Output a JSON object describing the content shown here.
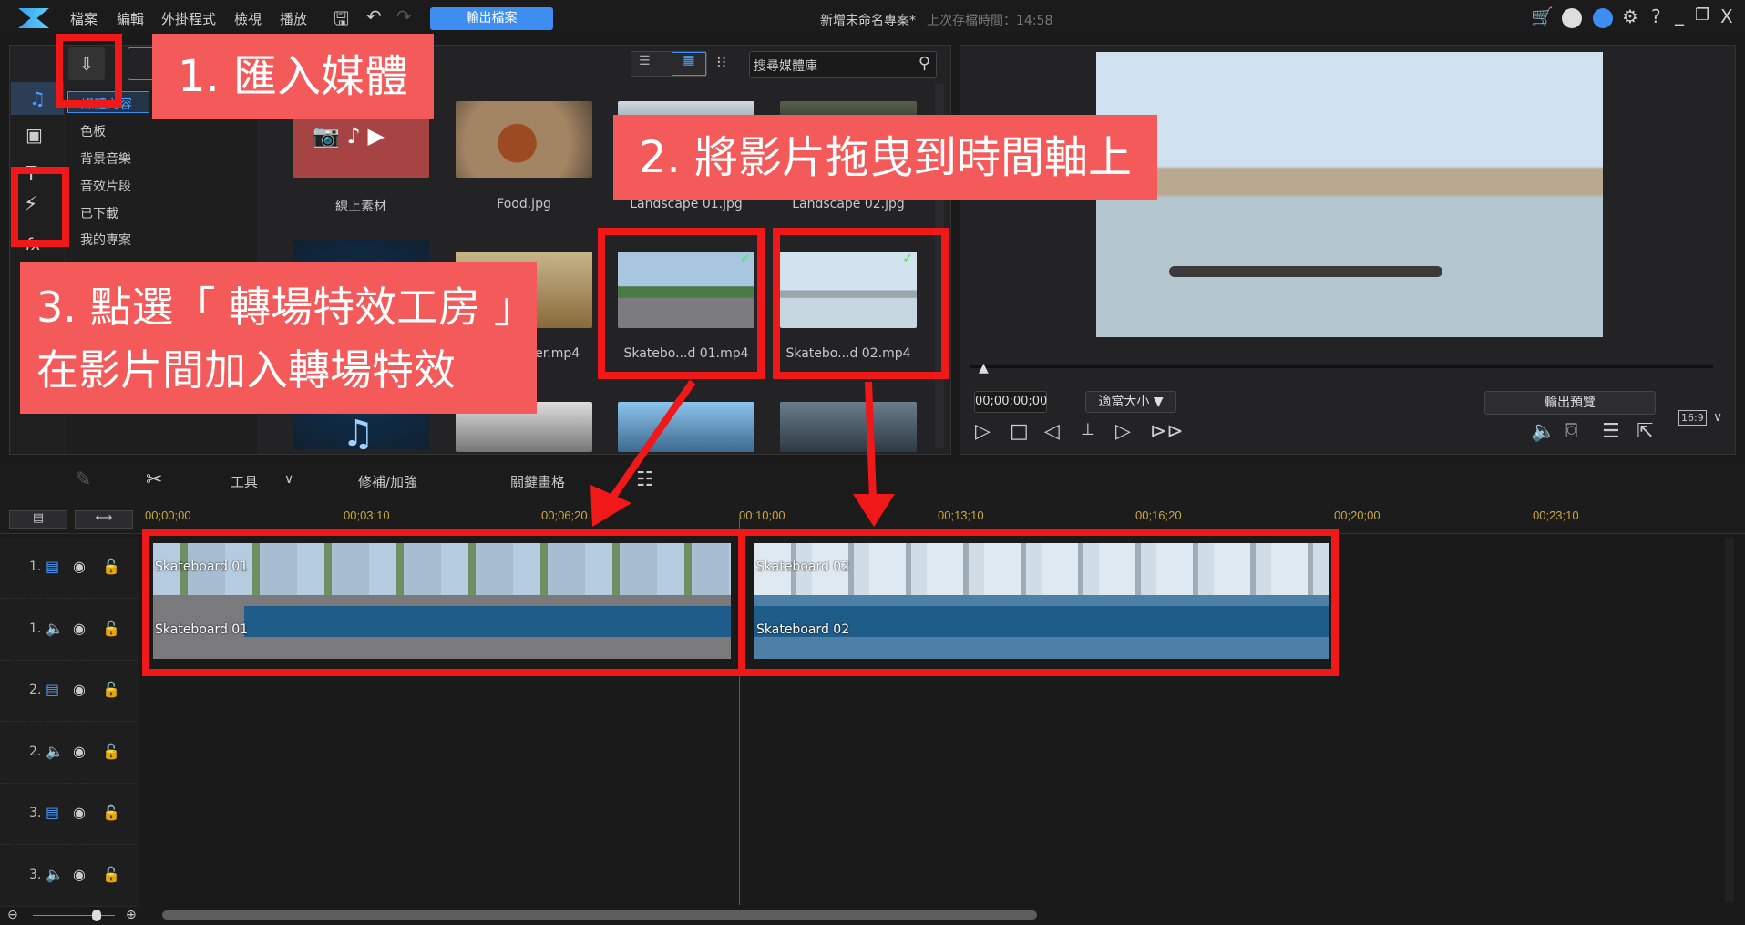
{
  "titlebar": {
    "menus": [
      "檔案",
      "編輯",
      "外掛程式",
      "檢視",
      "播放"
    ],
    "export_label": "輸出檔案",
    "project_title": "新增未命名專案*",
    "last_saved": "上次存檔時間：14:58"
  },
  "library": {
    "search_placeholder": "搜尋媒體庫",
    "categories": [
      "媒體內容",
      "色板",
      "背景音樂",
      "音效片段",
      "已下載",
      "我的專案"
    ],
    "items": [
      {
        "label": "線上素材"
      },
      {
        "label": "Food.jpg"
      },
      {
        "label": "Landscape 01.jpg"
      },
      {
        "label": "Landscape 02.jpg"
      },
      {
        "label": ""
      },
      {
        "label": "...er.mp4"
      },
      {
        "label": "Skatebo...d 01.mp4"
      },
      {
        "label": "Skatebo...d 02.mp4"
      }
    ]
  },
  "callouts": {
    "step1": "1. 匯入媒體",
    "step2": "2. 將影片拖曳到時間軸上",
    "step3_line1": "3. 點選「 轉場特效工房 」",
    "step3_line2": "在影片間加入轉場特效"
  },
  "preview": {
    "timecode": "00;00;00;00",
    "fit_label": "適當大小 ▼",
    "export_preview": "輸出預覽",
    "aspect": "16:9"
  },
  "timeline_toolbar": {
    "tools": "工具",
    "fix": "修補/加強",
    "keyframe": "關鍵畫格"
  },
  "ruler": [
    "00;00;00",
    "00;03;10",
    "00;06;20",
    "00;10;00",
    "00;13;10",
    "00;16;20",
    "00;20;00",
    "00;23;10"
  ],
  "tracks": [
    {
      "num": "1.",
      "type": "video"
    },
    {
      "num": "1.",
      "type": "audio"
    },
    {
      "num": "2.",
      "type": "video"
    },
    {
      "num": "2.",
      "type": "audio"
    },
    {
      "num": "3.",
      "type": "video"
    },
    {
      "num": "3.",
      "type": "audio"
    }
  ],
  "clips": [
    {
      "video": "Skateboard 01",
      "audio": "Skateboard 01"
    },
    {
      "video": "Skateboard 02",
      "audio": "Skateboard 02"
    }
  ],
  "colors": {
    "accent": "#3d8ef0",
    "annotation_red": "#f01818",
    "callout_bg": "#f45a5a",
    "ruler_text": "#c9a93a"
  }
}
